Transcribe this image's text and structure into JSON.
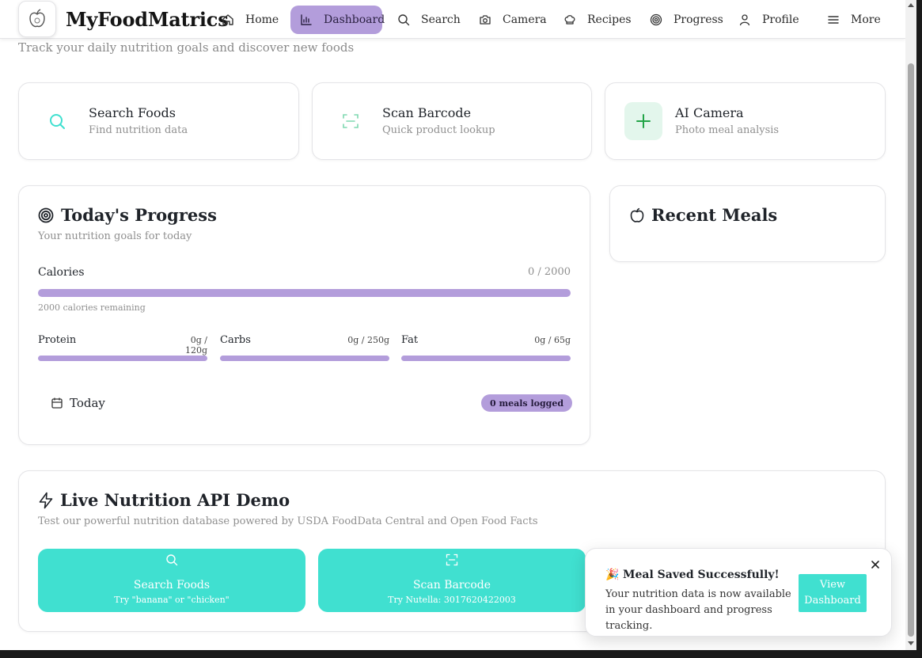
{
  "app": {
    "brand": "MyFoodMatrics",
    "subtitle": "Track your daily nutrition goals and discover new foods"
  },
  "nav": {
    "items": [
      {
        "label": "Home",
        "icon": "home-icon"
      },
      {
        "label": "Dashboard",
        "icon": "bar-chart-icon",
        "active": true
      },
      {
        "label": "Search",
        "icon": "search-icon"
      },
      {
        "label": "Camera",
        "icon": "camera-icon"
      },
      {
        "label": "Recipes",
        "icon": "chef-hat-icon"
      },
      {
        "label": "Progress",
        "icon": "target-icon"
      },
      {
        "label": "Profile",
        "icon": "user-icon"
      },
      {
        "label": "More",
        "icon": "menu-icon"
      }
    ]
  },
  "quick_actions": [
    {
      "title": "Search Foods",
      "subtitle": "Find nutrition data",
      "icon": "search-icon"
    },
    {
      "title": "Scan Barcode",
      "subtitle": "Quick product lookup",
      "icon": "scan-icon"
    },
    {
      "title": "AI Camera",
      "subtitle": "Photo meal analysis",
      "icon": "plus-icon"
    }
  ],
  "progress": {
    "title": "Today's Progress",
    "subtitle": "Your nutrition goals for today",
    "calories": {
      "label": "Calories",
      "value": "0 / 2000",
      "remaining": "2000 calories remaining",
      "fraction": 0
    },
    "macros": [
      {
        "label": "Protein",
        "value": "0g / 120g",
        "fraction": 0
      },
      {
        "label": "Carbs",
        "value": "0g / 250g",
        "fraction": 0
      },
      {
        "label": "Fat",
        "value": "0g / 65g",
        "fraction": 0
      }
    ],
    "day_label": "Today",
    "meals_badge": "0 meals logged"
  },
  "recent_meals": {
    "title": "Recent Meals"
  },
  "api_demo": {
    "title": "Live Nutrition API Demo",
    "subtitle": "Test our powerful nutrition database powered by USDA FoodData Central and Open Food Facts",
    "buttons": [
      {
        "label": "Search Foods",
        "hint": "Try \"banana\" or \"chicken\""
      },
      {
        "label": "Scan Barcode",
        "hint": "Try Nutella: 3017620422003"
      }
    ]
  },
  "toast": {
    "emoji": "🎉",
    "title": "Meal Saved Successfully!",
    "message": "Your nutrition data is now available in your dashboard and progress tracking.",
    "action": "View Dashboard"
  },
  "colors": {
    "accent_purple": "#b39ddb",
    "accent_turquoise": "#40e0d0",
    "green": "#22a447"
  }
}
